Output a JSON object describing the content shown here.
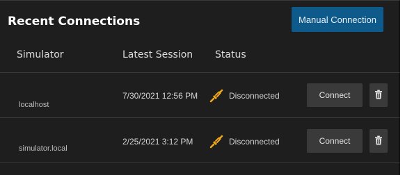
{
  "header": {
    "title": "Recent Connections",
    "manual_button_label": "Manual Connection"
  },
  "columns": {
    "simulator": "Simulator",
    "latest_session": "Latest Session",
    "status": "Status"
  },
  "rows": [
    {
      "simulator": "localhost",
      "latest_session": "7/30/2021 12:56 PM",
      "status": "Disconnected",
      "status_icon": "disconnected-plug-icon",
      "connect_label": "Connect"
    },
    {
      "simulator": "simulator.local",
      "latest_session": "2/25/2021 3:12 PM",
      "status": "Disconnected",
      "status_icon": "disconnected-plug-icon",
      "connect_label": "Connect"
    }
  ],
  "colors": {
    "background": "#1e1e1e",
    "primary_button": "#0e5a8a",
    "secondary_button": "#3a3a3a",
    "status_icon": "#f0a81c"
  }
}
